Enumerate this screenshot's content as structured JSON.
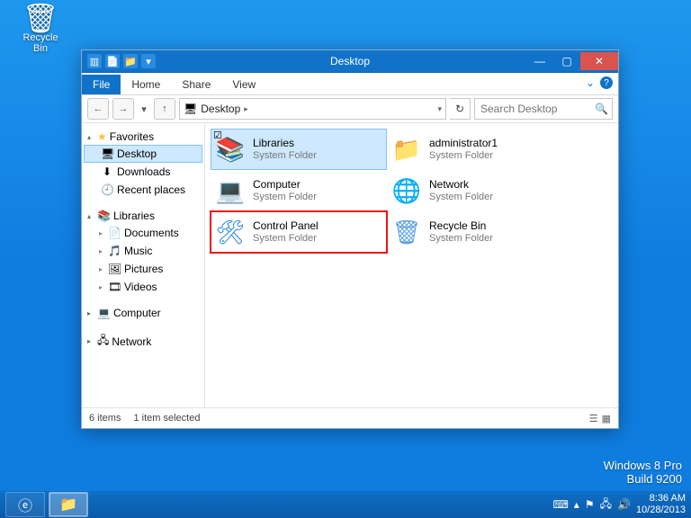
{
  "desktop": {
    "recycle_bin": "Recycle Bin"
  },
  "window": {
    "title": "Desktop",
    "ribbon": {
      "file": "File",
      "home": "Home",
      "share": "Share",
      "view": "View"
    },
    "address": {
      "crumb": "Desktop",
      "icon": "🖥"
    },
    "search": {
      "placeholder": "Search Desktop"
    },
    "status": {
      "count": "6 items",
      "selected": "1 item selected"
    }
  },
  "tree": {
    "favorites": {
      "label": "Favorites",
      "items": [
        {
          "icon": "🖥",
          "label": "Desktop",
          "selected": true
        },
        {
          "icon": "⬇",
          "label": "Downloads",
          "selected": false
        },
        {
          "icon": "🕘",
          "label": "Recent places",
          "selected": false
        }
      ]
    },
    "libraries": {
      "label": "Libraries",
      "items": [
        {
          "icon": "📄",
          "label": "Documents"
        },
        {
          "icon": "🎵",
          "label": "Music"
        },
        {
          "icon": "🖼",
          "label": "Pictures"
        },
        {
          "icon": "🎞",
          "label": "Videos"
        }
      ]
    },
    "computer": {
      "icon": "💻",
      "label": "Computer"
    },
    "network": {
      "icon": "🖧",
      "label": "Network"
    }
  },
  "items": [
    {
      "icon": "📚",
      "cls": "ic-libraries",
      "name": "Libraries",
      "type": "System Folder",
      "selected": true,
      "highlighted": false
    },
    {
      "icon": "📁",
      "cls": "ic-user",
      "name": "administrator1",
      "type": "System Folder",
      "selected": false,
      "highlighted": false
    },
    {
      "icon": "💻",
      "cls": "ic-computer",
      "name": "Computer",
      "type": "System Folder",
      "selected": false,
      "highlighted": false
    },
    {
      "icon": "🌐",
      "cls": "ic-network",
      "name": "Network",
      "type": "System Folder",
      "selected": false,
      "highlighted": false
    },
    {
      "icon": "🛠",
      "cls": "ic-cp",
      "name": "Control Panel",
      "type": "System Folder",
      "selected": false,
      "highlighted": true
    },
    {
      "icon": "🗑",
      "cls": "ic-rb",
      "name": "Recycle Bin",
      "type": "System Folder",
      "selected": false,
      "highlighted": false
    }
  ],
  "watermark": {
    "line1": "Windows 8 Pro",
    "line2": "Build 9200"
  },
  "clock": {
    "time": "8:36 AM",
    "date": "10/28/2013"
  }
}
